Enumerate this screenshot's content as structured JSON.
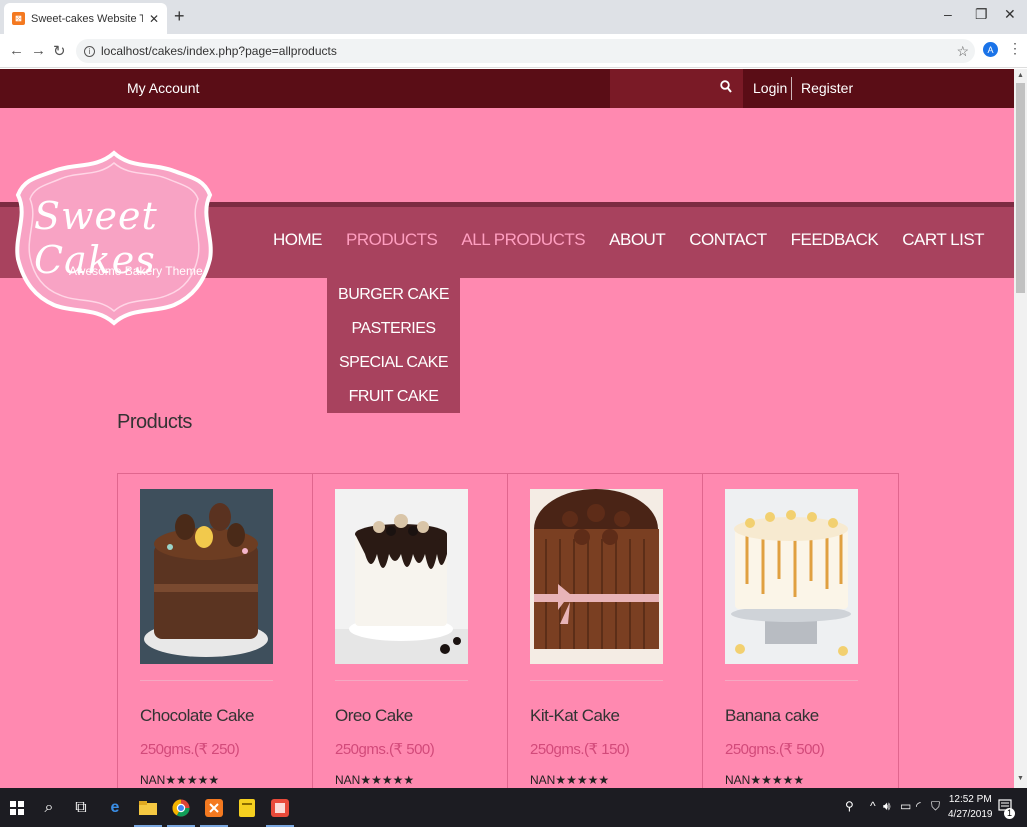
{
  "browser": {
    "tab_title": "Sweet-cakes Website Template |",
    "url": "localhost/cakes/index.php?page=allproducts",
    "avatar_letter": "A"
  },
  "topbar": {
    "my_account": "My Account",
    "login": "Login",
    "register": "Register"
  },
  "logo": {
    "title": "Sweet Cakes",
    "tagline": "Awesome Bakery Theme"
  },
  "nav": {
    "items": [
      {
        "label": "HOME"
      },
      {
        "label": "PRODUCTS"
      },
      {
        "label": "ALL PRODUCTS"
      },
      {
        "label": "ABOUT"
      },
      {
        "label": "CONTACT"
      },
      {
        "label": "FEEDBACK"
      },
      {
        "label": "CART LIST"
      }
    ]
  },
  "dropdown": {
    "items": [
      {
        "label": "BURGER CAKE"
      },
      {
        "label": "PASTERIES"
      },
      {
        "label": "SPECIAL CAKE"
      },
      {
        "label": "FRUIT CAKE"
      }
    ]
  },
  "products": {
    "title": "Products",
    "items": [
      {
        "name": "Chocolate Cake",
        "price": "250gms.(₹ 250)",
        "rating": "NAN★★★★★"
      },
      {
        "name": "Oreo Cake",
        "price": "250gms.(₹ 500)",
        "rating": "NAN★★★★★"
      },
      {
        "name": "Kit-Kat Cake",
        "price": "250gms.(₹ 150)",
        "rating": "NAN★★★★★"
      },
      {
        "name": "Banana cake",
        "price": "250gms.(₹ 500)",
        "rating": "NAN★★★★★"
      }
    ]
  },
  "taskbar": {
    "time": "12:52 PM",
    "date": "4/27/2019",
    "notif_count": "1"
  },
  "colors": {
    "page_bg": "#ff89b0",
    "topbar": "#5a0d16",
    "nav_band": "#a8425e",
    "price": "#d24a7a"
  }
}
